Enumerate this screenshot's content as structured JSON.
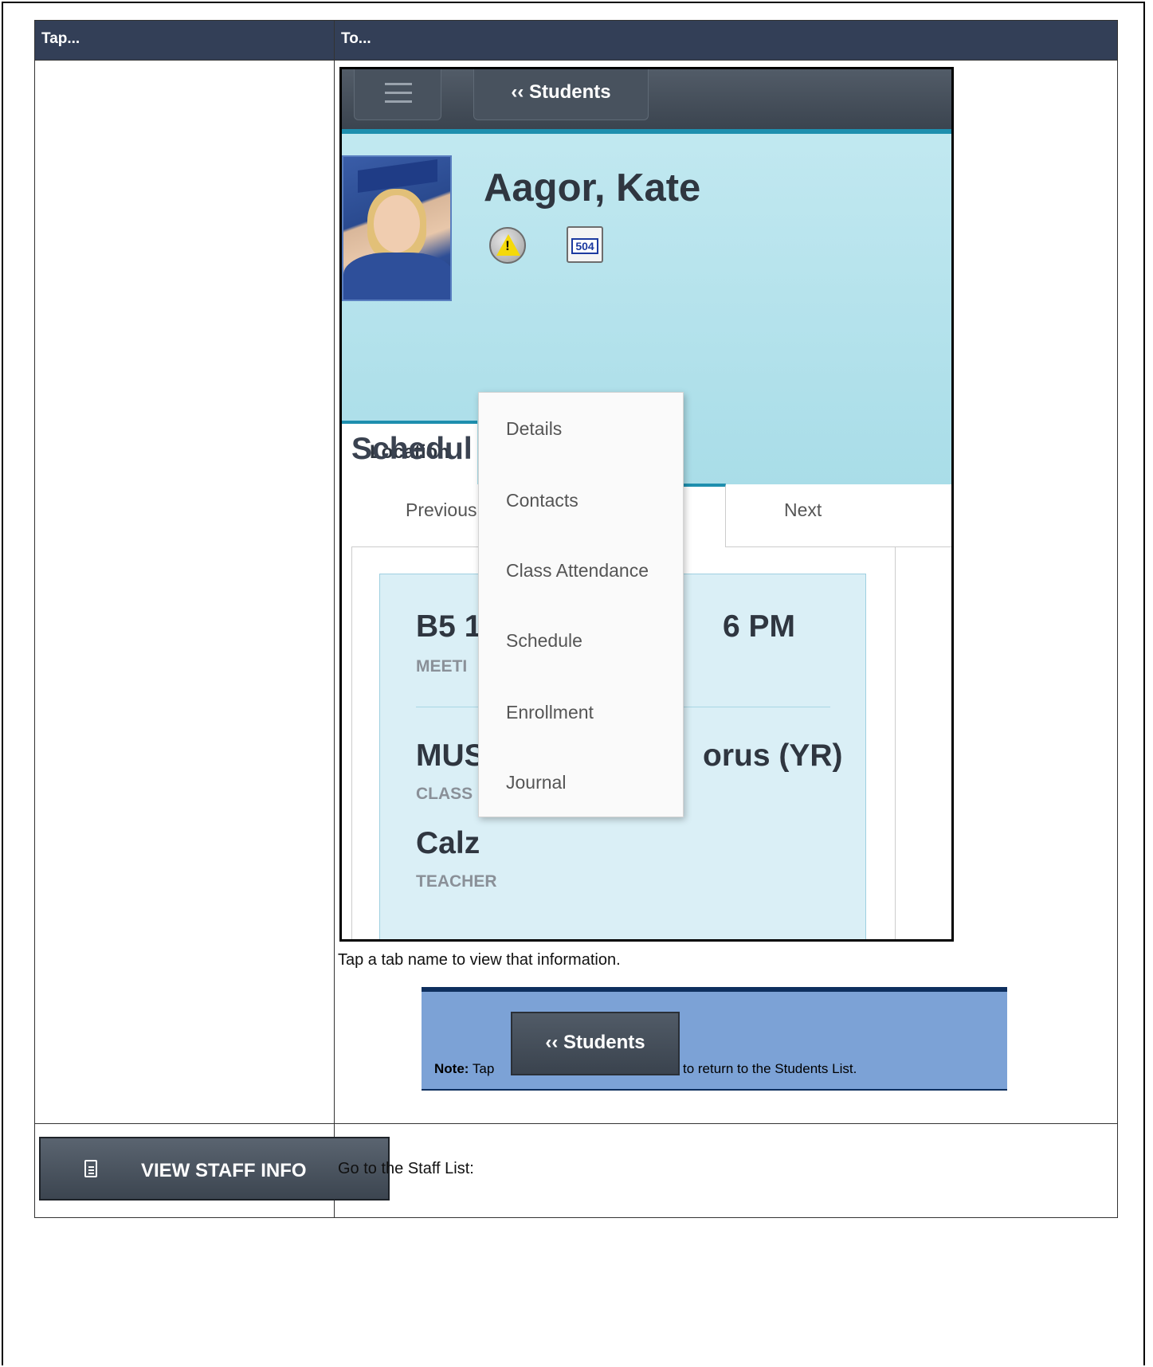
{
  "table": {
    "headers": [
      "Tap...",
      "To..."
    ]
  },
  "phone": {
    "back_button_label": "‹‹ Students",
    "student_name": "Aagor, Kate",
    "badge_504": "504",
    "tab_location": "Location",
    "section_title": "Schedul",
    "nav_previous": "Previous",
    "nav_next": "Next",
    "card": {
      "row1_value": "B5 1",
      "row1_value_right": "6 PM",
      "row1_label": "MEETI",
      "row2_value": "MUS",
      "row2_value_right": "orus (YR)",
      "row2_label": "CLASS",
      "row3_value": "Calz",
      "row3_label": "TEACHER"
    },
    "menu_items": [
      "Details",
      "Contacts",
      "Class Attendance",
      "Schedule",
      "Enrollment",
      "Journal"
    ]
  },
  "hint": "Tap a tab name to view that information.",
  "note": {
    "prefix": "Note:",
    "tap": "Tap",
    "button_label": "‹‹ Students",
    "suffix": "to return to the Students List."
  },
  "staff_row": {
    "button_label": "VIEW STAFF INFO",
    "description": "Go to the Staff List:"
  }
}
